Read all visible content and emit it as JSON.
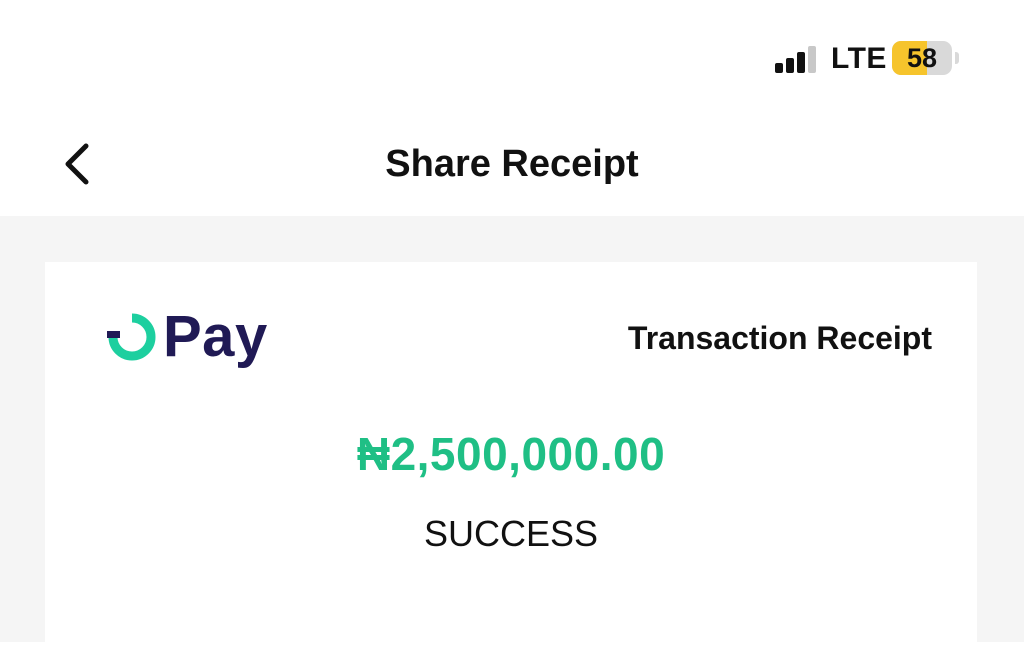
{
  "status_bar": {
    "network": "LTE",
    "signal_bars_active": 3,
    "signal_bars_total": 4,
    "battery_level": "58",
    "battery_percent": 58,
    "battery_color": "#f6c42c"
  },
  "header": {
    "back_icon": "chevron-left-icon",
    "title": "Share Receipt"
  },
  "receipt": {
    "logo": {
      "text": "Pay",
      "mark_color": "#1dcf9f",
      "text_color": "#201a55"
    },
    "title": "Transaction Receipt",
    "amount": "₦2,500,000.00",
    "amount_color": "#1fbf85",
    "status": "SUCCESS"
  }
}
